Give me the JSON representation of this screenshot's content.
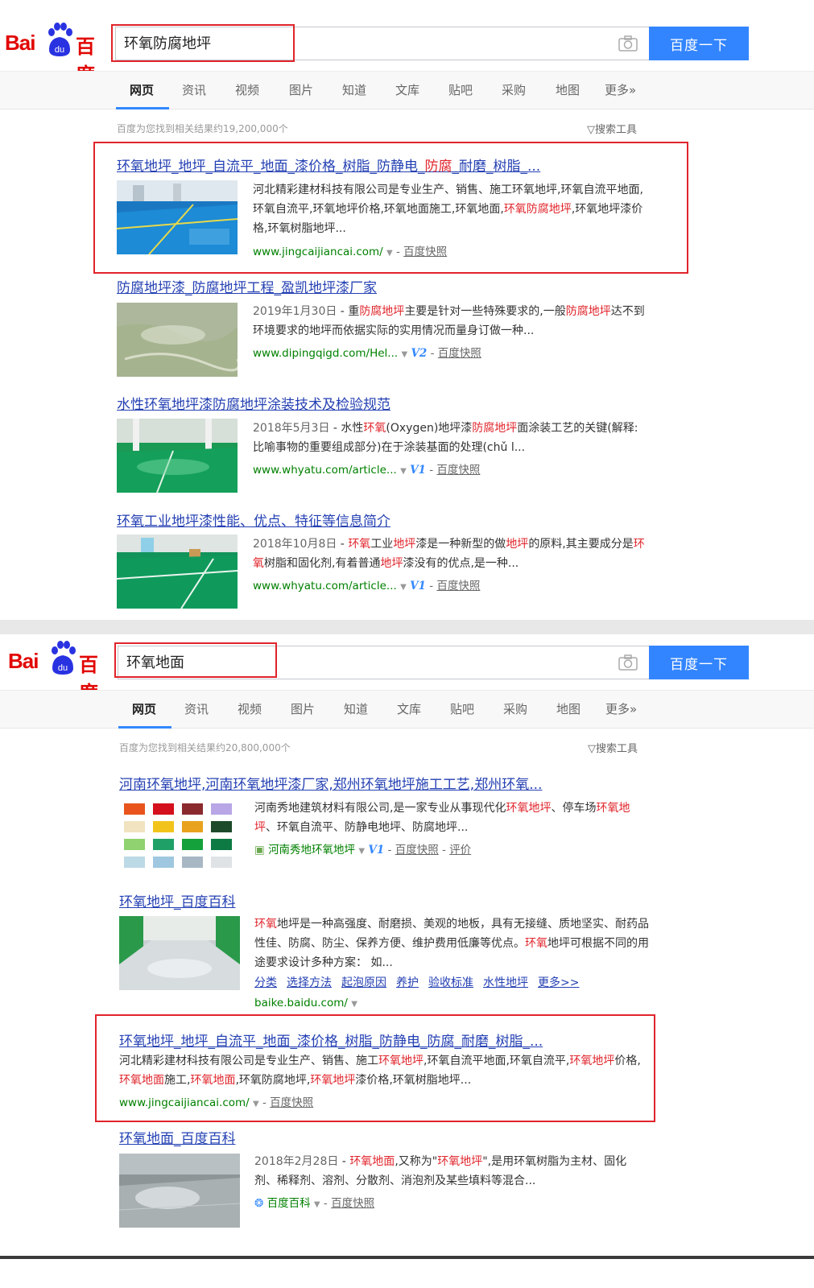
{
  "brand": {
    "bai": "Bai",
    "du": "du",
    "baidu_cn": "百度"
  },
  "search_button_label": "百度一下",
  "tabs": [
    "网页",
    "资讯",
    "视频",
    "图片",
    "知道",
    "文库",
    "贴吧",
    "采购",
    "地图",
    "更多»"
  ],
  "search_tools_label": "搜索工具",
  "search1": {
    "query": "环氧防腐地坪",
    "stats": "百度为您找到相关结果约19,200,000个",
    "results": [
      {
        "title": [
          "环氧地坪_地坪_自流平_地面_漆价格_树脂_防静电_",
          "防腐",
          "_耐磨_树脂_..."
        ],
        "abstract": [
          "河北精彩建材科技有限公司是专业生产、销售、施工环氧地坪,环氧自流平地面,环氧自流平,环氧地坪价格,环氧地面施工,环氧地面,",
          "环氧防腐地坪",
          ",环氧地坪漆价格,环氧树脂地坪..."
        ],
        "url": "www.jingcaijiancai.com/",
        "kuaizhao": "百度快照"
      },
      {
        "title": [
          "防腐地坪漆_防腐地坪工程_盈凯地坪漆厂家"
        ],
        "date": "2019年1月30日",
        "abstract": [
          "重",
          "防腐地坪",
          "主要是针对一些特殊要求的,一般",
          "防腐地坪",
          "达不到环境要求的地坪而依据实际的实用情况而量身订做一种..."
        ],
        "url": "www.dipingqigd.com/Hel...",
        "badge": "V2",
        "kuaizhao": "百度快照"
      },
      {
        "title": [
          "水性环氧地坪漆防腐地坪涂装技术及检验规范"
        ],
        "date": "2018年5月3日",
        "abstract": [
          "水性",
          "环氧",
          "(Oxygen)地坪漆",
          "防腐地坪",
          "面涂装工艺的关键(解释:比喻事物的重要组成部分)在于涂装基面的处理(chǔ l..."
        ],
        "url": "www.whyatu.com/article...",
        "badge": "V1",
        "kuaizhao": "百度快照"
      },
      {
        "title": [
          "环氧工业地坪漆性能、优点、特征等信息简介"
        ],
        "date": "2018年10月8日",
        "abstract": [
          "环氧",
          "工业",
          "地坪",
          "漆是一种新型的做",
          "地坪",
          "的原料,其主要成分是",
          "环氧",
          "树脂和固化剂,有着普通",
          "地坪",
          "漆没有的优点,是一种..."
        ],
        "url": "www.whyatu.com/article...",
        "badge": "V1",
        "kuaizhao": "百度快照"
      }
    ]
  },
  "search2": {
    "query": "环氧地面",
    "stats": "百度为您找到相关结果约20,800,000个",
    "results": [
      {
        "title": [
          "河南环氧地坪,河南环氧地坪漆厂家,郑州环氧地坪施工工艺,郑州环氧..."
        ],
        "abstract": [
          "河南秀地建筑材料有限公司,是一家专业从事现代化",
          "环氧地坪",
          "、停车场",
          "环氧地坪",
          "、环氧自流平、防静电地坪、防腐地坪..."
        ],
        "site_name": "河南秀地环氧地坪",
        "badge": "V1",
        "kuaizhao": "百度快照",
        "pingjia": "评价"
      },
      {
        "title": [
          "环氧地坪_百度百科"
        ],
        "abstract": [
          "环氧",
          "地坪是一种高强度、耐磨损、美观的地板，具有无接缝、质地坚实、耐药品性佳、防腐、防尘、保养方便、维护费用低廉等优点。",
          "环氧",
          "地坪可根据不同的用途要求设计多种方案： 如..."
        ],
        "sublinks": [
          "分类",
          "选择方法",
          "起泡原因",
          "养护",
          "验收标准",
          "水性地坪",
          "更多>>"
        ],
        "url": "baike.baidu.com/"
      },
      {
        "title": [
          "环氧地坪_地坪_自流平_地面_漆价格_树脂_防静电_防腐_耐磨_树脂_..."
        ],
        "abstract": [
          "河北精彩建材科技有限公司是专业生产、销售、施工",
          "环氧地坪",
          ",环氧自流平地面,环氧自流平,",
          "环氧地坪",
          "价格,",
          "环氧地面",
          "施工,",
          "环氧地面",
          ",环氧防腐地坪,",
          "环氧地坪",
          "漆价格,环氧树脂地坪..."
        ],
        "url": "www.jingcaijiancai.com/",
        "kuaizhao": "百度快照"
      },
      {
        "title": [
          "环氧地面_百度百科"
        ],
        "date": "2018年2月28日",
        "abstract": [
          "环氧地面",
          ",又称为\"",
          "环氧地坪",
          "\",是用环氧树脂为主材、固化剂、稀释剂、溶剂、分散剂、消泡剂及某些填料等混合..."
        ],
        "site_name": "百度百科",
        "kuaizhao": "百度快照"
      }
    ]
  },
  "colors": {
    "link": "#2440b3",
    "em": "#e0242b",
    "url": "#008000",
    "button": "#3385ff",
    "highlight_box": "#e0242b"
  }
}
